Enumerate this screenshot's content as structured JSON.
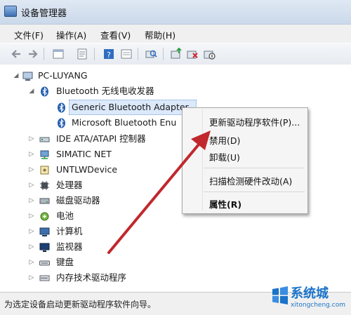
{
  "window": {
    "title": "设备管理器"
  },
  "menu": [
    {
      "label": "文件(F)"
    },
    {
      "label": "操作(A)"
    },
    {
      "label": "查看(V)"
    },
    {
      "label": "帮助(H)"
    }
  ],
  "toolbar": {
    "buttons": [
      "back-icon",
      "forward-icon",
      "properties-panel-icon",
      "update-list-icon",
      "help-icon",
      "show-console-icon",
      "scan-hardware-icon",
      "update-driver-icon",
      "uninstall-icon",
      "disable-icon"
    ]
  },
  "tree": {
    "root": "PC-LUYANG",
    "bluetooth_group": "Bluetooth 无线电收发器",
    "bt_child_1": "Generic Bluetooth Adapter",
    "bt_child_2": "Microsoft Bluetooth Enu",
    "categories": [
      {
        "label": "IDE ATA/ATAPI 控制器",
        "icon": "ide-controller-icon"
      },
      {
        "label": "SIMATIC NET",
        "icon": "network-icon"
      },
      {
        "label": "UNTLWDevice",
        "icon": "device-icon"
      },
      {
        "label": "处理器",
        "icon": "processor-icon"
      },
      {
        "label": "磁盘驱动器",
        "icon": "disk-drive-icon"
      },
      {
        "label": "电池",
        "icon": "battery-icon"
      },
      {
        "label": "计算机",
        "icon": "computer-icon"
      },
      {
        "label": "监视器",
        "icon": "monitor-icon"
      },
      {
        "label": "键盘",
        "icon": "keyboard-icon"
      },
      {
        "label": "内存技术驱动程序",
        "icon": "memory-icon"
      }
    ]
  },
  "context_menu": {
    "update_driver": "更新驱动程序软件(P)...",
    "disable": "禁用(D)",
    "uninstall": "卸载(U)",
    "scan": "扫描检测硬件改动(A)",
    "properties": "属性(R)"
  },
  "status": {
    "text": "为选定设备启动更新驱动程序软件向导。"
  },
  "watermark": {
    "brand": "系统城",
    "url": "xitongcheng.com"
  },
  "colors": {
    "accent": "#1a73c9",
    "arrow": "#c0282d"
  }
}
